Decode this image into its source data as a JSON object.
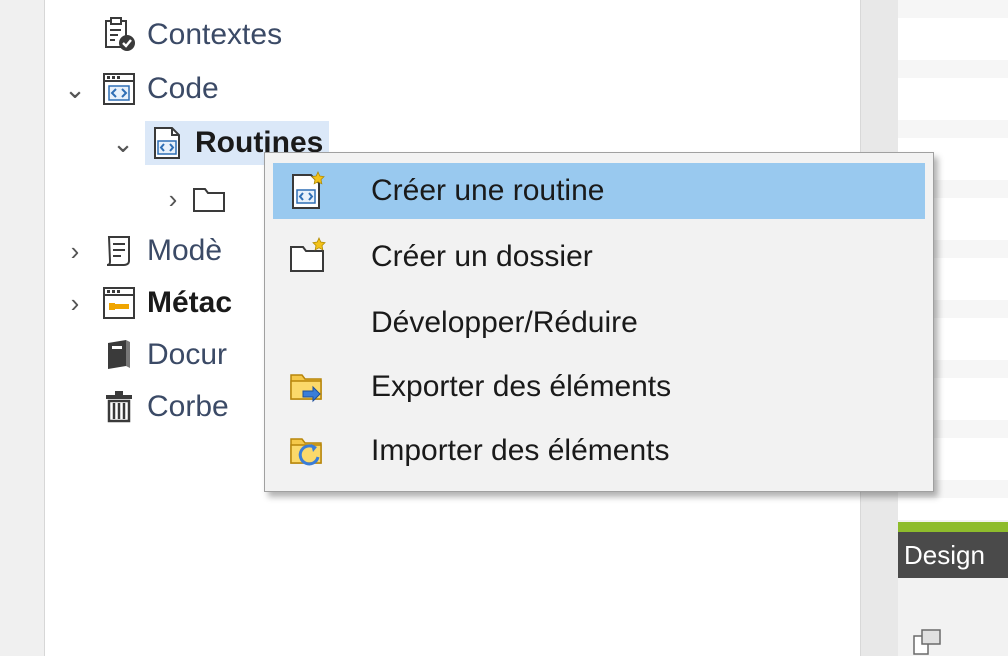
{
  "tree": {
    "items": [
      {
        "label": "Contextes",
        "icon": "contexts-icon"
      },
      {
        "label": "Code",
        "icon": "code-folder-icon"
      },
      {
        "label": "Routines",
        "icon": "routine-icon"
      },
      {
        "label": "",
        "icon": "folder-icon"
      },
      {
        "label": "Modè",
        "icon": "document-template-icon"
      },
      {
        "label": "Métac",
        "icon": "metadata-icon"
      },
      {
        "label": "Docur",
        "icon": "book-icon"
      },
      {
        "label": "Corbe",
        "icon": "trash-icon"
      }
    ]
  },
  "context_menu": {
    "items": [
      {
        "label": "Créer une routine",
        "icon": "new-routine-icon",
        "highlighted": true
      },
      {
        "label": "Créer un dossier",
        "icon": "new-folder-icon"
      },
      {
        "label": "Développer/Réduire",
        "icon": ""
      },
      {
        "label": "Exporter des éléments",
        "icon": "export-icon"
      },
      {
        "label": "Importer des éléments",
        "icon": "import-icon"
      }
    ]
  },
  "right_panel": {
    "design_tab_label": "Design"
  },
  "colors": {
    "highlight": "#99c9ef",
    "selection": "#dbe8f8",
    "accent_green": "#8ebc2c"
  }
}
